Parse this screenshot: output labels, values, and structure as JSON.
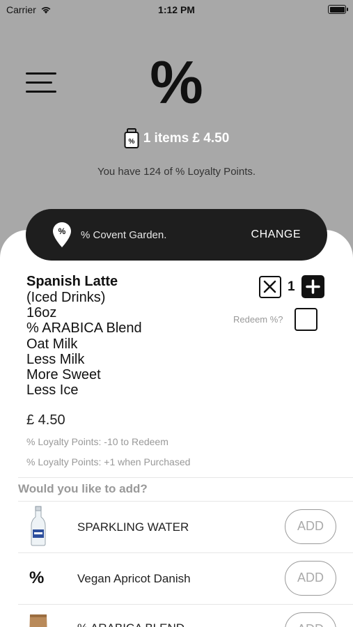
{
  "status_bar": {
    "carrier": "Carrier",
    "time": "1:12 PM"
  },
  "header": {
    "logo": "%",
    "cart_summary": "1 items £ 4.50",
    "cart_badge": "%",
    "loyalty_text": "You have 124 of % Loyalty Points."
  },
  "store": {
    "pin_label": "%",
    "name": "% Covent Garden.",
    "change_label": "CHANGE"
  },
  "item": {
    "name": "Spanish Latte",
    "details": [
      "(Iced Drinks)",
      "16oz",
      "% ARABICA Blend",
      "Oat Milk",
      "Less Milk",
      "More Sweet",
      "Less Ice"
    ],
    "quantity": "1",
    "redeem_label": "Redeem %?",
    "price": "£ 4.50",
    "loyalty_redeem": "% Loyalty Points: -10 to Redeem",
    "loyalty_earn": "% Loyalty Points: +1 when Purchased"
  },
  "addons": {
    "title": "Would you like to add?",
    "items": [
      {
        "name": "SPARKLING WATER",
        "button": "ADD",
        "icon": "water-bottle-icon"
      },
      {
        "name": "Vegan Apricot Danish",
        "button": "ADD",
        "icon": "percent-logo-icon",
        "glyph": "%"
      },
      {
        "name": "% ARABICA BLEND",
        "button": "ADD",
        "icon": "coffee-bag-icon"
      }
    ]
  }
}
